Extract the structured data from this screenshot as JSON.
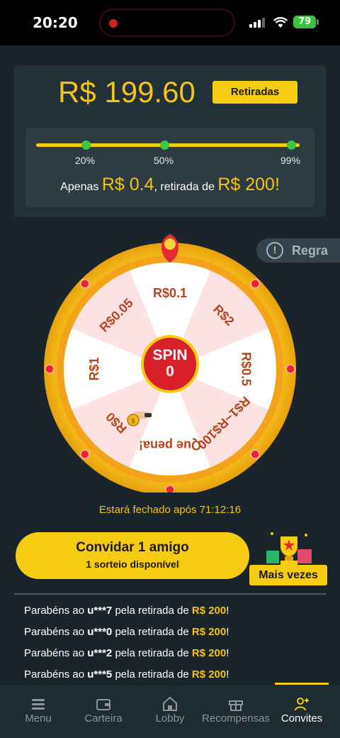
{
  "status": {
    "time": "20:20",
    "battery": "79"
  },
  "balance": {
    "amount": "R$ 199.60",
    "withdraw_label": "Retiradas"
  },
  "progress": {
    "value_percent": 99,
    "markers": [
      "20%",
      "50%",
      "99%"
    ],
    "message_prefix": "Apenas",
    "message_amount": "R$ 0.4",
    "message_middle": ", retirada de",
    "message_target": "R$ 200!"
  },
  "rule_label": "Regra",
  "wheel": {
    "segments": [
      "R$0.1",
      "R$2",
      "R$0.5",
      "R$1~R$100",
      "Que pena!",
      "R$0",
      "R$1",
      "R$0.05"
    ],
    "spin_label": "SPIN",
    "spin_count": "0",
    "colors": {
      "rim": "#f6cc13",
      "segment_light": "#ffffff",
      "segment_pink": "#fde2e4",
      "text": "#b5461d",
      "center": "#d8202a"
    }
  },
  "closing_text": "Estará fechado após 71:12:16",
  "invite": {
    "title": "Convidar 1 amigo",
    "subtitle": "1 sorteio disponível"
  },
  "more_label": "Mais vezes",
  "winners": [
    {
      "pre": "Parabéns ao",
      "user": "u***7",
      "mid": "pela retirada de",
      "amount": "R$ 200",
      "end": "!"
    },
    {
      "pre": "Parabéns ao",
      "user": "u***0",
      "mid": "pela retirada de",
      "amount": "R$ 200",
      "end": "!"
    },
    {
      "pre": "Parabéns ao",
      "user": "u***2",
      "mid": "pela retirada de",
      "amount": "R$ 200",
      "end": "!"
    },
    {
      "pre": "Parabéns ao",
      "user": "u***5",
      "mid": "pela retirada de",
      "amount": "R$ 200",
      "end": "!"
    }
  ],
  "nav": [
    {
      "label": "Menu",
      "icon": "menu-icon"
    },
    {
      "label": "Carteira",
      "icon": "wallet-icon"
    },
    {
      "label": "Lobby",
      "icon": "home-icon"
    },
    {
      "label": "Recompensas",
      "icon": "gift-icon"
    },
    {
      "label": "Convites",
      "icon": "add-user-icon",
      "active": true
    }
  ],
  "accent_color": "#f6cc13"
}
